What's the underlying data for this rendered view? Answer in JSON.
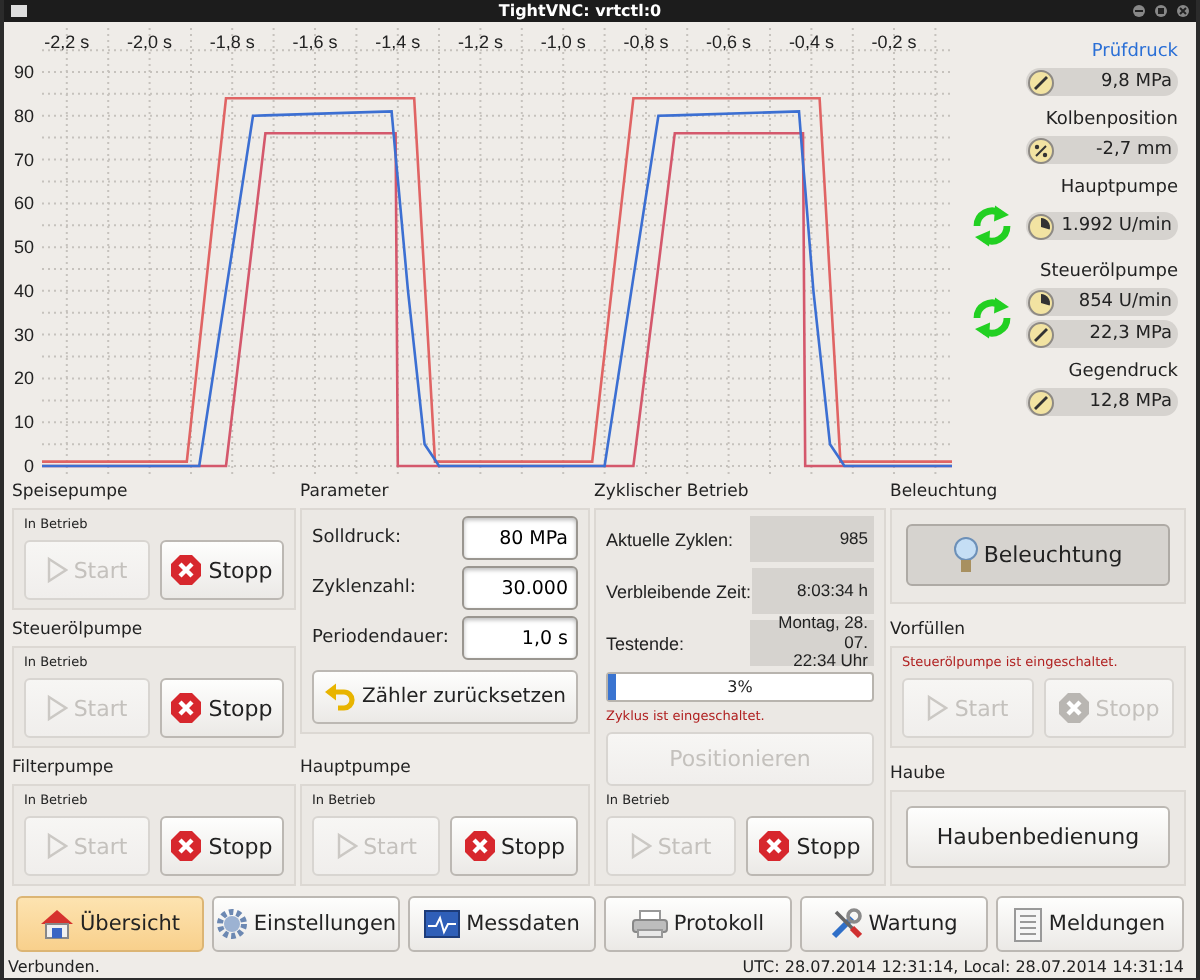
{
  "window": {
    "title": "TightVNC: vrtctl:0"
  },
  "chart": {
    "chart_data": {
      "type": "line",
      "x": [
        -2.26,
        -1.91,
        -1.88,
        -1.815,
        -1.75,
        -1.72,
        -1.415,
        -1.405,
        -1.4,
        -1.375,
        -1.36,
        -1.335,
        -1.31,
        -1.3,
        -0.93,
        -0.9,
        -0.83,
        -0.77,
        -0.73,
        -0.43,
        -0.42,
        -0.415,
        -0.395,
        -0.38,
        -0.355,
        -0.33,
        -0.32,
        -0.06
      ],
      "series": [
        {
          "color": "#e06464",
          "values": [
            1,
            1,
            27.2,
            84,
            84,
            84,
            84,
            84,
            84,
            84,
            84,
            42.5,
            1,
            1,
            1,
            25.9,
            84,
            84,
            84,
            84,
            84,
            84,
            84,
            84,
            42.5,
            1,
            1,
            1
          ]
        },
        {
          "color": "#d4586c",
          "values": [
            0,
            0,
            0,
            0,
            52,
            76,
            76,
            76,
            0,
            0,
            0,
            0,
            0,
            0,
            0,
            0,
            0,
            45.6,
            76,
            76,
            76,
            0,
            0,
            0,
            0,
            0,
            0,
            0
          ]
        },
        {
          "color": "#3c6fd2",
          "values": [
            0,
            0,
            0,
            40,
            80,
            80.1,
            81,
            70.8,
            65.6,
            40,
            26.9,
            5,
            1.4,
            0,
            0,
            0,
            43.1,
            80,
            80.1,
            81,
            69.3,
            63.4,
            40,
            26.9,
            5,
            1.4,
            0,
            0
          ]
        }
      ],
      "xlim": [
        -2.26,
        -0.06
      ],
      "ylim": [
        0,
        90
      ],
      "grid": true,
      "xticks": [
        {
          "value": -2.2,
          "label": "-2,2 s"
        },
        {
          "value": -2.0,
          "label": "-2,0 s"
        },
        {
          "value": -1.8,
          "label": "-1,8 s"
        },
        {
          "value": -1.6,
          "label": "-1,6 s"
        },
        {
          "value": -1.4,
          "label": "-1,4 s"
        },
        {
          "value": -1.2,
          "label": "-1,2 s"
        },
        {
          "value": -1.0,
          "label": "-1,0 s"
        },
        {
          "value": -0.8,
          "label": "-0,8 s"
        },
        {
          "value": -0.6,
          "label": "-0,6 s"
        },
        {
          "value": -0.4,
          "label": "-0,4 s"
        },
        {
          "value": -0.2,
          "label": "-0,2 s"
        }
      ],
      "yticks": [
        0,
        10,
        20,
        30,
        40,
        50,
        60,
        70,
        80,
        90
      ]
    }
  },
  "gauges": [
    {
      "label": "Prüfdruck",
      "selected": true,
      "running": false,
      "readings": [
        {
          "kind": "pressure",
          "value": "9,8 MPa"
        }
      ]
    },
    {
      "label": "Kolbenposition",
      "selected": false,
      "running": false,
      "readings": [
        {
          "kind": "position",
          "value": "-2,7 mm"
        }
      ]
    },
    {
      "label": "Hauptpumpe",
      "selected": false,
      "running": true,
      "readings": [
        {
          "kind": "speed",
          "value": "1.992 U/min"
        }
      ]
    },
    {
      "label": "Steuerölpumpe",
      "selected": false,
      "running": true,
      "readings": [
        {
          "kind": "speed",
          "value": "854 U/min"
        },
        {
          "kind": "pressure",
          "value": "22,3 MPa"
        }
      ]
    },
    {
      "label": "Gegendruck",
      "selected": false,
      "running": false,
      "readings": [
        {
          "kind": "pressure",
          "value": "12,8 MPa"
        }
      ]
    }
  ],
  "columns": [
    [
      {
        "kind": "pump",
        "title": "Speisepumpe",
        "status": {
          "text": "In Betrieb",
          "alert": false
        },
        "buttons": [
          {
            "kind": "start",
            "label": "Start",
            "disabled": true
          },
          {
            "kind": "stop",
            "label": "Stopp",
            "disabled": false
          }
        ]
      },
      {
        "kind": "pump",
        "title": "Steuerölpumpe",
        "status": {
          "text": "In Betrieb",
          "alert": false
        },
        "buttons": [
          {
            "kind": "start",
            "label": "Start",
            "disabled": true
          },
          {
            "kind": "stop",
            "label": "Stopp",
            "disabled": false
          }
        ]
      },
      {
        "kind": "pump",
        "title": "Filterpumpe",
        "status": {
          "text": "In Betrieb",
          "alert": false
        },
        "buttons": [
          {
            "kind": "start",
            "label": "Start",
            "disabled": true
          },
          {
            "kind": "stop",
            "label": "Stopp",
            "disabled": false
          }
        ]
      }
    ],
    [
      {
        "kind": "parameters",
        "title": "Parameter",
        "fields": [
          {
            "label": "Solldruck:",
            "value": "80 MPa"
          },
          {
            "label": "Zyklenzahl:",
            "value": "30.000"
          },
          {
            "label": "Periodendauer:",
            "value": "1,0 s"
          }
        ],
        "button": {
          "kind": "reset",
          "label": "Zähler zurücksetzen",
          "disabled": false
        }
      },
      {
        "kind": "pump",
        "title": "Hauptpumpe",
        "status": {
          "text": "In Betrieb",
          "alert": false
        },
        "buttons": [
          {
            "kind": "start",
            "label": "Start",
            "disabled": true
          },
          {
            "kind": "stop",
            "label": "Stopp",
            "disabled": false
          }
        ]
      }
    ],
    [
      {
        "kind": "cyclic",
        "title": "Zyklischer Betrieb",
        "readouts": [
          {
            "label": "Aktuelle Zyklen:",
            "value": "985"
          },
          {
            "label": "Verbleibende Zeit:",
            "value": "8:03:34 h"
          },
          {
            "label": "Testende:",
            "value": "Montag, 28. 07.\n22:34 Uhr"
          }
        ],
        "progress": {
          "level": 0.03,
          "text": "3%"
        },
        "message": {
          "text": "Zyklus ist eingeschaltet.",
          "alert": true
        },
        "action": {
          "kind": "plain",
          "label": "Positionieren",
          "disabled": true
        },
        "pump": {
          "status": {
            "text": "In Betrieb",
            "alert": false
          },
          "buttons": [
            {
              "kind": "start",
              "label": "Start",
              "disabled": true
            },
            {
              "kind": "stop",
              "label": "Stopp",
              "disabled": false
            }
          ]
        }
      }
    ],
    [
      {
        "kind": "single",
        "title": "Beleuchtung",
        "button": {
          "kind": "light",
          "label": "Beleuchtung",
          "disabled": false,
          "on": true
        }
      },
      {
        "kind": "pump",
        "title": "Vorfüllen",
        "status": {
          "text": "Steuerölpumpe ist eingeschaltet.",
          "alert": true
        },
        "buttons": [
          {
            "kind": "start",
            "label": "Start",
            "disabled": true
          },
          {
            "kind": "stop",
            "label": "Stopp",
            "disabled": true
          }
        ]
      },
      {
        "kind": "single",
        "title": "Haube",
        "button": {
          "kind": "plain",
          "label": "Haubenbedienung",
          "disabled": false,
          "on": false
        }
      }
    ]
  ],
  "nav": [
    {
      "label": "Übersicht",
      "selected": true
    },
    {
      "label": "Einstellungen",
      "selected": false
    },
    {
      "label": "Messdaten",
      "selected": false
    },
    {
      "label": "Protokoll",
      "selected": false
    },
    {
      "label": "Wartung",
      "selected": false
    },
    {
      "label": "Meldungen",
      "selected": false
    }
  ],
  "status_bar": {
    "left": "Verbunden.",
    "right": "UTC: 28.07.2014 12:31:14, Local: 28.07.2014 14:31:14"
  }
}
